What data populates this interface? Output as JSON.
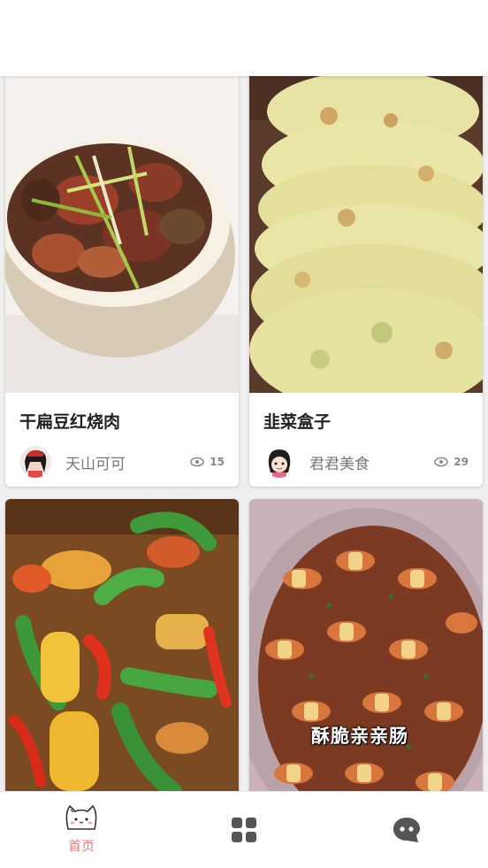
{
  "cards": [
    {
      "title": "干扁豆红烧肉",
      "author": "天山可可",
      "views": "15"
    },
    {
      "title": "韭菜盒子",
      "author": "君君美食",
      "views": "29"
    },
    {
      "title": "",
      "author": "",
      "views": ""
    },
    {
      "title": "",
      "author": "",
      "views": "",
      "overlay": "酥脆亲亲肠"
    }
  ],
  "tabs": [
    {
      "label": "首页",
      "icon": "cat-icon",
      "active": true
    },
    {
      "label": "",
      "icon": "grid-icon",
      "active": false
    },
    {
      "label": "",
      "icon": "chat-icon",
      "active": false
    }
  ],
  "colors": {
    "accent": "#f0797a",
    "background": "#efefef"
  }
}
